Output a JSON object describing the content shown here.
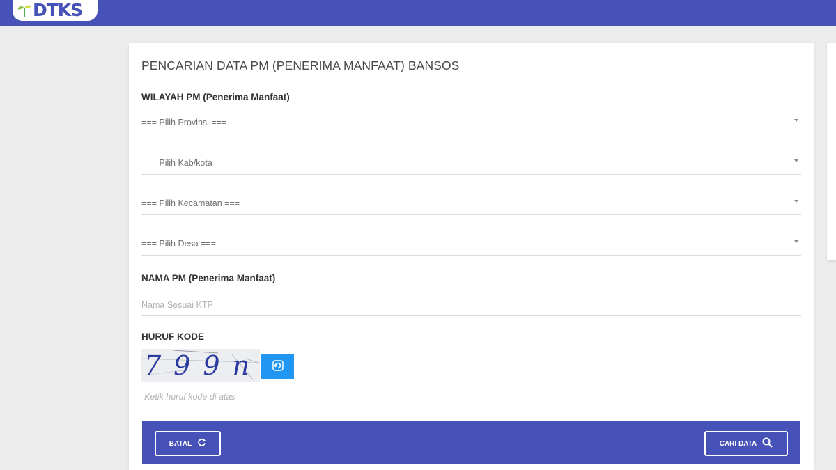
{
  "header": {
    "logo_text": "DTKS",
    "brand_color": "#4652b8"
  },
  "form": {
    "title": "PENCARIAN DATA PM (PENERIMA MANFAAT) BANSOS",
    "wilayah_label": "WILAYAH PM (Penerima Manfaat)",
    "selects": {
      "provinsi": "=== Pilih Provinsi ===",
      "kabkota": "=== Pilih Kab/kota ===",
      "kecamatan": "=== Pilih Kecamatan ===",
      "desa": "=== Pilih Desa ==="
    },
    "nama_label": "NAMA PM (Penerima Manfaat)",
    "nama_placeholder": "Nama Sesuai KTP",
    "kode_label": "HURUF KODE",
    "captcha_text": "799n",
    "kode_placeholder": "Ketik huruf kode di atas"
  },
  "actions": {
    "batal_label": "BATAL",
    "cari_label": "CARI DATA"
  },
  "icons": {
    "logo": "leaf-logo-icon",
    "caret": "chevron-down-icon",
    "refresh": "refresh-icon",
    "batal": "reload-icon",
    "cari": "search-icon"
  },
  "colors": {
    "accent": "#4652b8",
    "refresh_button": "#2196f3"
  }
}
